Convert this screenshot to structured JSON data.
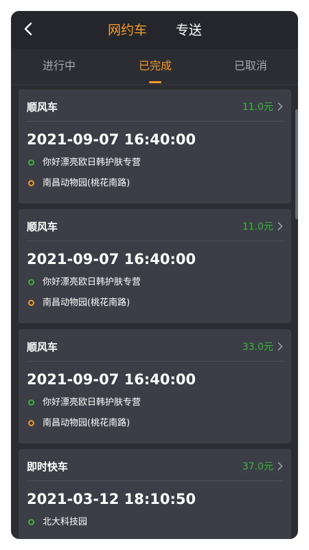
{
  "header": {
    "segments": [
      "网约车",
      "专送"
    ],
    "active_segment": 0
  },
  "tabs": {
    "items": [
      "进行中",
      "已完成",
      "已取消"
    ],
    "active": 1
  },
  "orders": [
    {
      "type": "顺风车",
      "price": "11.0元",
      "time": "2021-09-07 16:40:00",
      "start": "你好漂亮欧日韩护肤专营",
      "end": "南昌动物园(桃花南路)"
    },
    {
      "type": "顺风车",
      "price": "11.0元",
      "time": "2021-09-07 16:40:00",
      "start": "你好漂亮欧日韩护肤专营",
      "end": "南昌动物园(桃花南路)"
    },
    {
      "type": "顺风车",
      "price": "33.0元",
      "time": "2021-09-07 16:40:00",
      "start": "你好漂亮欧日韩护肤专营",
      "end": "南昌动物园(桃花南路)"
    },
    {
      "type": "即时快车",
      "price": "37.0元",
      "time": "2021-03-12 18:10:50",
      "start": "北大科技园",
      "end": ""
    }
  ],
  "colors": {
    "accent": "#f29b29",
    "price": "#3fb33f",
    "card": "#3b3e46",
    "background": "#2b2d33"
  },
  "icons": {
    "back": "back-chevron-icon",
    "row": "chevron-right-icon",
    "start": "start-point-dot-icon",
    "end": "end-point-dot-icon"
  }
}
